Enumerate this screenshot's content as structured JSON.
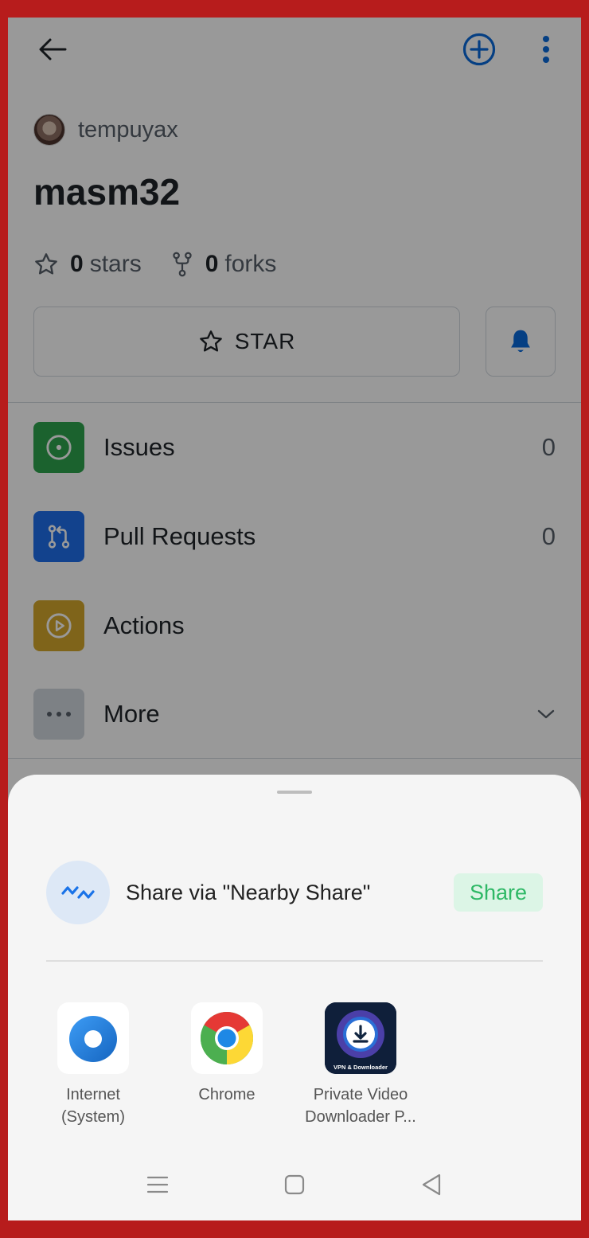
{
  "repo": {
    "owner": "tempuyax",
    "name": "masm32",
    "stars_count": "0",
    "stars_label": "stars",
    "forks_count": "0",
    "forks_label": "forks",
    "star_button_label": "STAR"
  },
  "menu": [
    {
      "label": "Issues",
      "count": "0",
      "color": "#2da44e",
      "icon": "issue-icon"
    },
    {
      "label": "Pull Requests",
      "count": "0",
      "color": "#1f6feb",
      "icon": "pull-request-icon"
    },
    {
      "label": "Actions",
      "count": "",
      "color": "#d4a72c",
      "icon": "play-icon"
    },
    {
      "label": "More",
      "count": "",
      "color": "#d0d7de",
      "icon": "ellipsis-icon"
    }
  ],
  "share_sheet": {
    "nearby_label": "Share via \"Nearby Share\"",
    "share_button": "Share",
    "apps": [
      {
        "line1": "Internet",
        "line2": "(System)",
        "icon": "internet-icon"
      },
      {
        "line1": "Chrome",
        "line2": "",
        "icon": "chrome-icon"
      },
      {
        "line1": "Private Video",
        "line2": "Downloader P...",
        "icon": "video-downloader-icon",
        "badge_text": "VPN & Downloader"
      }
    ]
  },
  "colors": {
    "accent": "#0969da",
    "frame": "#b71c1c",
    "share_green": "#2eb866"
  },
  "icons": {
    "back": "arrow-left-icon",
    "add": "plus-circle-icon",
    "more": "kebab-menu-icon",
    "star": "star-icon",
    "fork": "fork-icon",
    "bell": "bell-icon",
    "nearby": "nearby-share-icon",
    "nav_recents": "recents-icon",
    "nav_home": "home-icon",
    "nav_back": "nav-back-icon"
  }
}
